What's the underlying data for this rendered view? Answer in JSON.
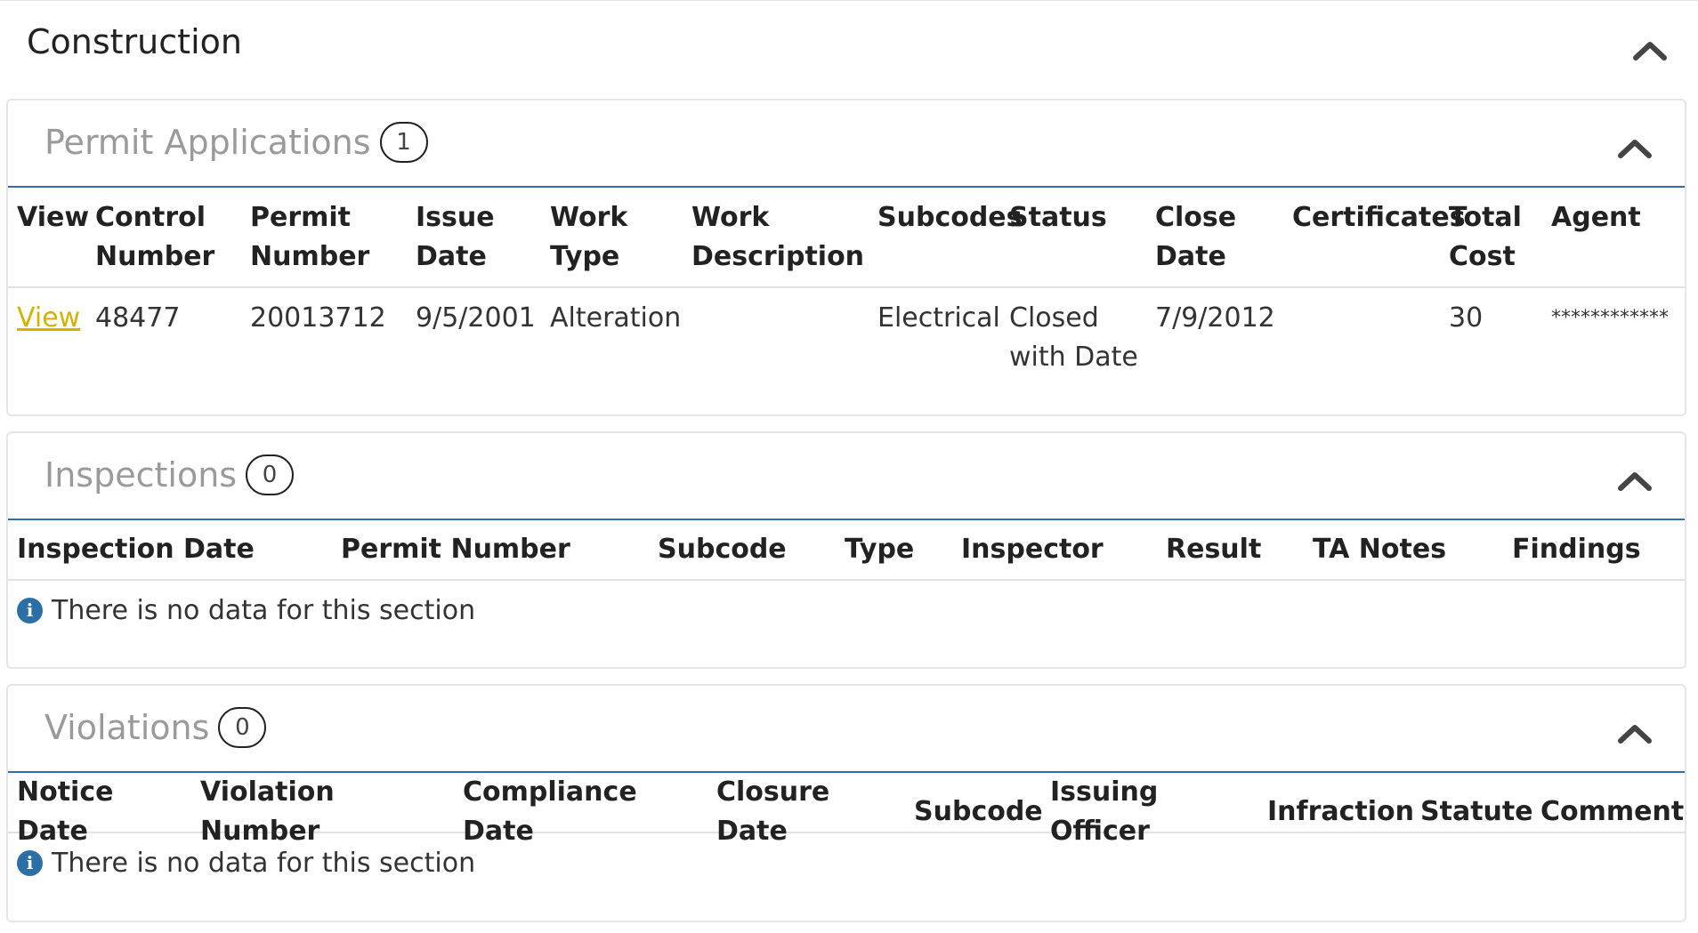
{
  "construction": {
    "title": "Construction"
  },
  "permits": {
    "title": "Permit Applications",
    "count": "1",
    "columns": [
      [
        "View"
      ],
      [
        "Control",
        "Number"
      ],
      [
        "Permit",
        "Number"
      ],
      [
        "Issue",
        "Date"
      ],
      [
        "Work",
        "Type"
      ],
      [
        "Work",
        "Description"
      ],
      [
        "Subcodes"
      ],
      [
        "Status"
      ],
      [
        "Close",
        "Date"
      ],
      [
        "Certificates"
      ],
      [
        "Total",
        "Cost"
      ],
      [
        "Agent"
      ]
    ],
    "rows": [
      {
        "view_link": "View",
        "control_number": "48477",
        "permit_number": "20013712",
        "issue_date": "9/5/2001",
        "work_type": "Alteration",
        "work_description": "",
        "subcodes": "Electrical",
        "status_line1": "Closed",
        "status_line2": "with Date",
        "close_date": "7/9/2012",
        "certificates": "",
        "total_cost": "30",
        "agent": "************"
      }
    ]
  },
  "inspections": {
    "title": "Inspections",
    "count": "0",
    "columns": [
      "Inspection Date",
      "Permit Number",
      "Subcode",
      "Type",
      "Inspector",
      "Result",
      "TA Notes",
      "Findings"
    ],
    "empty_message": "There is no data for this section"
  },
  "violations": {
    "title": "Violations",
    "count": "0",
    "columns": [
      "Notice Date",
      "Violation Number",
      "Compliance Date",
      "Closure Date",
      "Subcode",
      "Issuing Officer",
      "Infraction",
      "Statute",
      "Comment"
    ],
    "empty_message": "There is no data for this section"
  },
  "icons": {
    "collapse": "chevron-up-icon",
    "info": "info-icon"
  },
  "colors": {
    "link": "#d4b300",
    "accent_border": "#2f6db0",
    "info_icon": "#2b6fa6",
    "panel_title": "#9a9a9a"
  }
}
